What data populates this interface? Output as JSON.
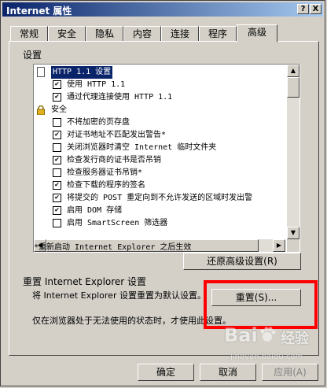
{
  "window": {
    "title": "Internet 属性"
  },
  "titlebar_buttons": {
    "help": "?",
    "close": "X"
  },
  "tabs": [
    {
      "label": "常规"
    },
    {
      "label": "安全"
    },
    {
      "label": "隐私"
    },
    {
      "label": "内容"
    },
    {
      "label": "连接"
    },
    {
      "label": "程序"
    },
    {
      "label": "高级",
      "active": true
    }
  ],
  "settings": {
    "group_label": "设置",
    "items": [
      {
        "kind": "category",
        "icon": "page-icon",
        "label": "HTTP 1.1 设置"
      },
      {
        "kind": "checkbox",
        "checked": true,
        "label": "使用 HTTP 1.1"
      },
      {
        "kind": "checkbox",
        "checked": true,
        "label": "通过代理连接使用 HTTP 1.1"
      },
      {
        "kind": "category",
        "icon": "lock-icon",
        "label": "安全"
      },
      {
        "kind": "checkbox",
        "checked": false,
        "label": "不将加密的页存盘"
      },
      {
        "kind": "checkbox",
        "checked": true,
        "label": "对证书地址不匹配发出警告*"
      },
      {
        "kind": "checkbox",
        "checked": false,
        "label": "关闭浏览器时清空 Internet 临时文件夹"
      },
      {
        "kind": "checkbox",
        "checked": true,
        "label": "检查发行商的证书是否吊销"
      },
      {
        "kind": "checkbox",
        "checked": false,
        "label": "检查服务器证书吊销*"
      },
      {
        "kind": "checkbox",
        "checked": true,
        "label": "检查下载的程序的签名"
      },
      {
        "kind": "checkbox",
        "checked": true,
        "label": "将提交的 POST 重定向到不允许发送的区域时发出警"
      },
      {
        "kind": "checkbox",
        "checked": true,
        "label": "启用 DOM 存储"
      },
      {
        "kind": "checkbox",
        "checked": false,
        "label": "启用 SmartScreen 筛选器"
      }
    ],
    "restart_note": "*重新启动 Internet Explorer 之后生效",
    "restore_button": "还原高级设置(R)"
  },
  "reset": {
    "group_label": "重置 Internet Explorer 设置",
    "description": "将 Internet Explorer 设置重置为默认设置。",
    "button": "重置(S)...",
    "note": "仅在浏览器处于无法使用的状态时，才使用此设置。"
  },
  "footer": {
    "ok": "确定",
    "cancel": "取消",
    "apply": "应用(A)"
  },
  "watermark": {
    "brand": "Bai",
    "brand_suffix": "经验",
    "url": "jingyan.baidu.com"
  },
  "colors": {
    "highlight_box": "#ff0000",
    "titlebar": "#0a246a"
  }
}
